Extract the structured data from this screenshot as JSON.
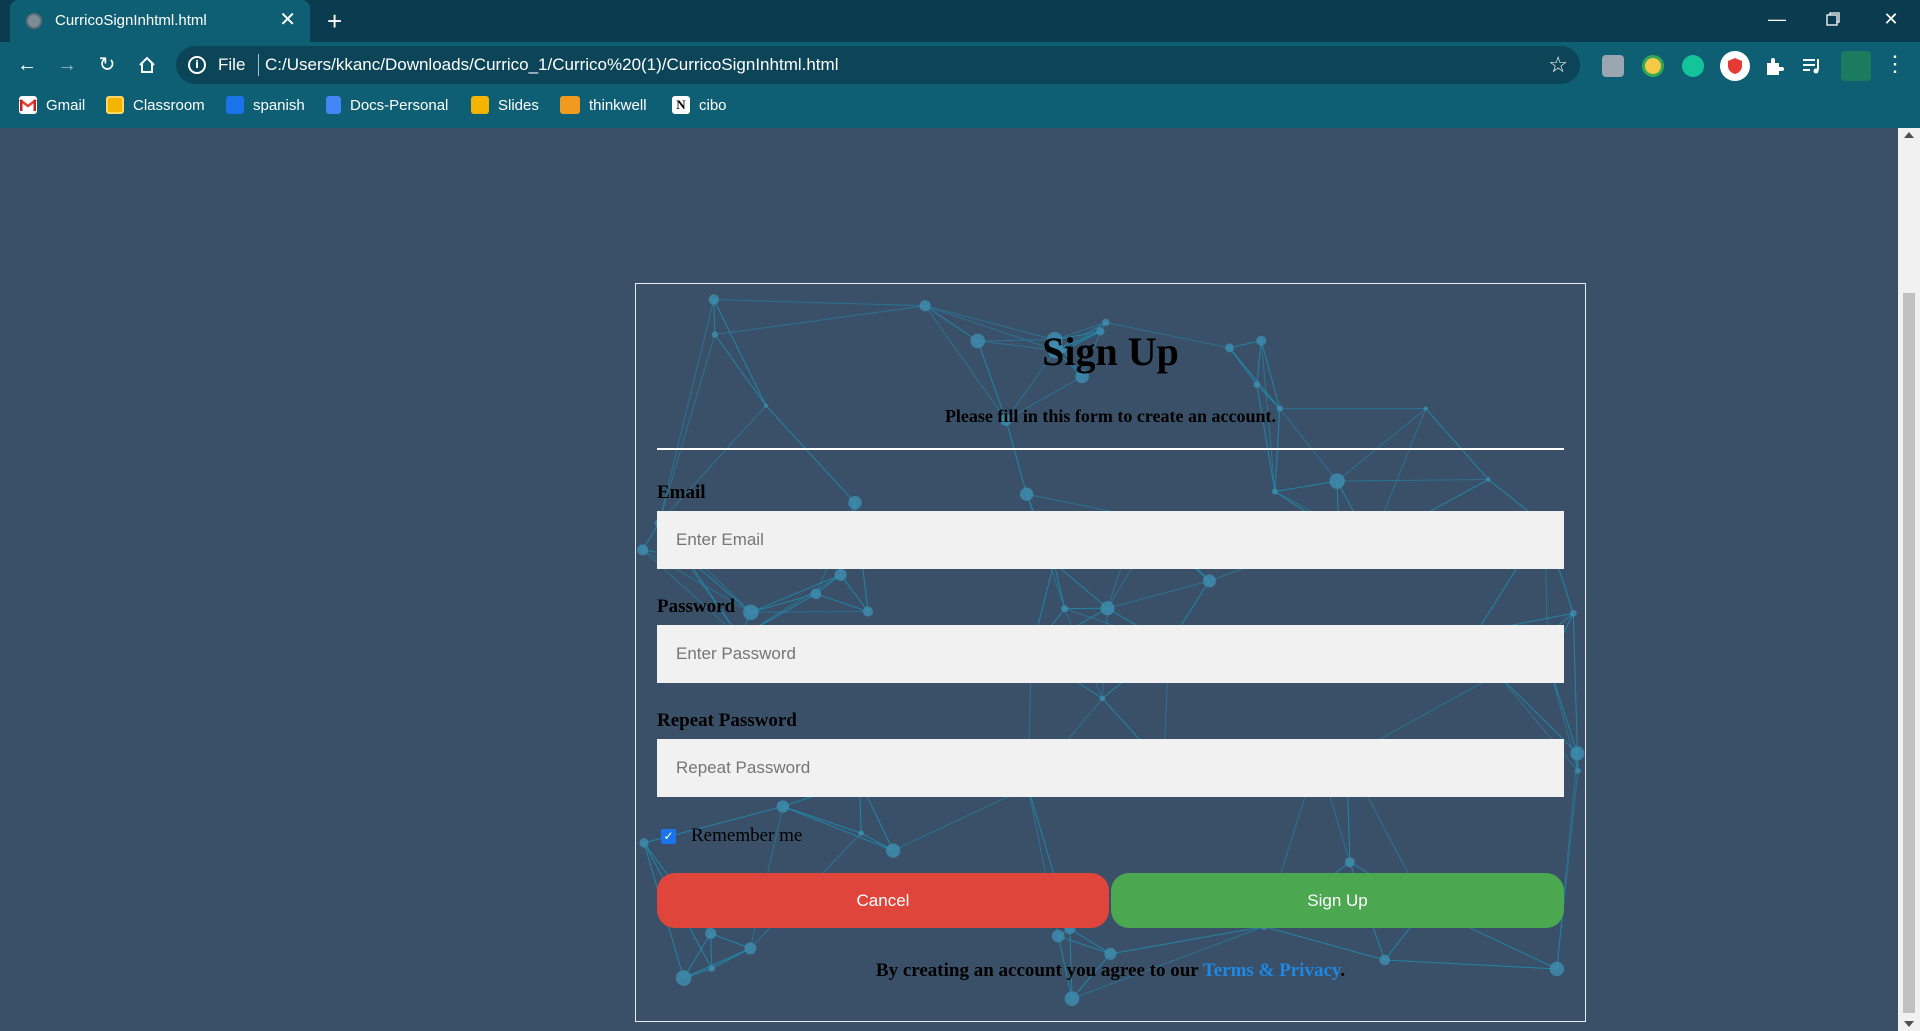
{
  "browser": {
    "tab_title": "CurricoSignInhtml.html",
    "tab_close": "✕",
    "new_tab": "+",
    "omnibox": {
      "scheme_label": "File",
      "url": "C:/Users/kkanc/Downloads/Currico_1/Currico%20(1)/CurricoSignInhtml.html"
    },
    "bookmarks": [
      {
        "label": "Gmail",
        "icon": "gmail-icon",
        "color": "#ea4335"
      },
      {
        "label": "Classroom",
        "icon": "classroom-icon",
        "color": "#f4b400"
      },
      {
        "label": "spanish",
        "icon": "spanish-icon",
        "color": "#1a73e8"
      },
      {
        "label": "Docs-Personal",
        "icon": "docs-icon",
        "color": "#4285f4"
      },
      {
        "label": "Slides",
        "icon": "slides-icon",
        "color": "#f4b400"
      },
      {
        "label": "thinkwell",
        "icon": "thinkwell-icon",
        "color": "#f29a1f"
      },
      {
        "label": "cibo",
        "icon": "notion-icon",
        "color": "#ffffff"
      }
    ]
  },
  "form": {
    "title": "Sign Up",
    "subtitle": "Please fill in this form to create an account.",
    "email": {
      "label": "Email",
      "placeholder": "Enter Email"
    },
    "password": {
      "label": "Password",
      "placeholder": "Enter Password"
    },
    "repeat_password": {
      "label": "Repeat Password",
      "placeholder": "Repeat Password"
    },
    "remember_me": {
      "label": "Remember me",
      "checked": true
    },
    "cancel_label": "Cancel",
    "signup_label": "Sign Up",
    "terms": {
      "prefix": "By creating an account you agree to our ",
      "link": "Terms & Privacy",
      "suffix": "."
    }
  },
  "colors": {
    "page_background": "#3a5068",
    "chrome": "#0e5f74",
    "cancel_button": "#e0453c",
    "signup_button": "#4ba750",
    "link": "#1e88e5",
    "network_lines": "#1f8fb3"
  }
}
